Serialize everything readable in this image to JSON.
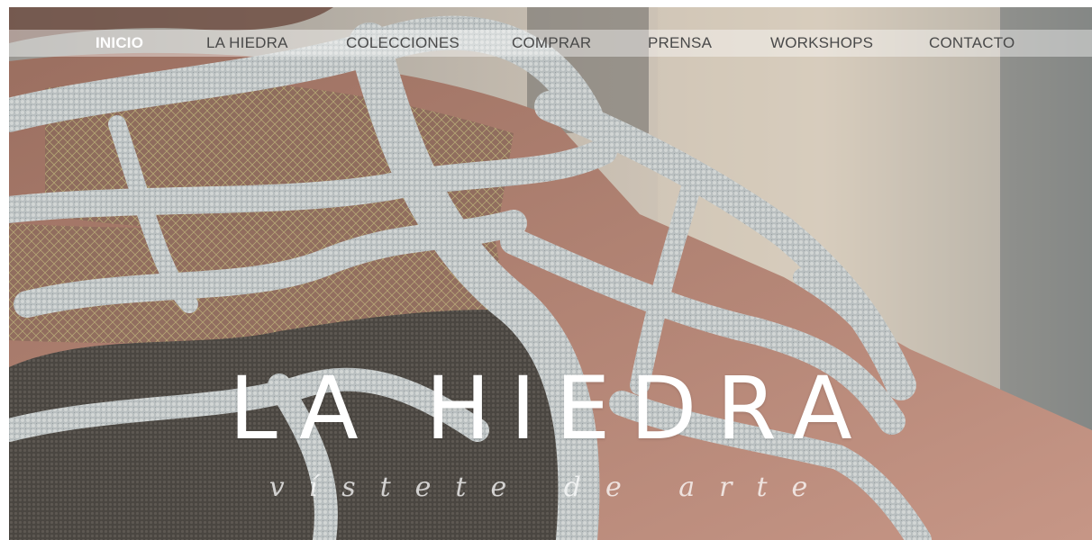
{
  "navigation": {
    "items": [
      {
        "label": "INICIO",
        "active": true
      },
      {
        "label": "LA HIEDRA",
        "active": false
      },
      {
        "label": "COLECCIONES",
        "active": false
      },
      {
        "label": "COMPRAR",
        "active": false
      },
      {
        "label": "PRENSA",
        "active": false
      },
      {
        "label": "WORKSHOPS",
        "active": false
      },
      {
        "label": "CONTACTO",
        "active": false
      }
    ]
  },
  "hero": {
    "image": "hero-photo: knitted lace garment on back and shoulder",
    "title": "LA HIEDRA",
    "tagline": "vístete de arte"
  },
  "colors": {
    "nav_bar": "#ffffff",
    "nav_text": "#4a4a4a",
    "nav_active": "#ffffff",
    "title": "#ffffff"
  }
}
